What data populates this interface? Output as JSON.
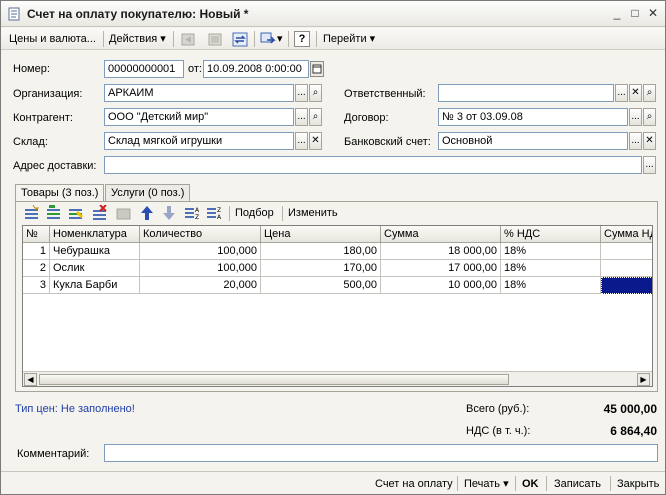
{
  "window": {
    "title": "Счет на оплату покупателю: Новый *",
    "minimize": "_",
    "maximize": "□",
    "close": "✕"
  },
  "toolbar": {
    "prices_label": "Цены и валюта...",
    "actions_label": "Действия",
    "help_label": "?",
    "goto_label": "Перейти"
  },
  "form": {
    "number_label": "Номер:",
    "number_value": "00000000001",
    "date_from_label": "от:",
    "date_value": "10.09.2008  0:00:00",
    "org_label": "Организация:",
    "org_value": "АРКАИМ",
    "responsible_label": "Ответственный:",
    "responsible_value": "",
    "contractor_label": "Контрагент:",
    "contractor_value": "ООО \"Детский мир\"",
    "contract_label": "Договор:",
    "contract_value": "№ 3 от 03.09.08",
    "warehouse_label": "Склад:",
    "warehouse_value": "Склад мягкой игрушки",
    "bank_label": "Банковский счет:",
    "bank_value": "Основной",
    "address_label": "Адрес доставки:",
    "address_value": ""
  },
  "tabs": [
    {
      "label": "Товары (3 поз.)",
      "active": true
    },
    {
      "label": "Услуги (0 поз.)",
      "active": false
    }
  ],
  "table_toolbar": {
    "pick_label": "Подбор",
    "edit_label": "Изменить"
  },
  "table": {
    "headers": [
      "№",
      "Номенклатура",
      "Количество",
      "Цена",
      "Сумма",
      "% НДС",
      "Сумма НДС"
    ],
    "rows": [
      {
        "n": "1",
        "item": "Чебурашка",
        "qty": "100,000",
        "price": "180,00",
        "sum": "18 000,00",
        "vat": "18%"
      },
      {
        "n": "2",
        "item": "Ослик",
        "qty": "100,000",
        "price": "170,00",
        "sum": "17 000,00",
        "vat": "18%"
      },
      {
        "n": "3",
        "item": "Кукла Барби",
        "qty": "20,000",
        "price": "500,00",
        "sum": "10 000,00",
        "vat": "18%"
      }
    ]
  },
  "footer": {
    "price_type": "Тип цен: Не заполнено!",
    "total_label": "Всего (руб.):",
    "total_value": "45 000,00",
    "vat_label": "НДС (в т. ч.):",
    "vat_value": "6 864,40",
    "comment_label": "Комментарий:",
    "comment_value": ""
  },
  "bottom": {
    "invoice_label": "Счет на оплату",
    "print_label": "Печать",
    "ok_label": "OK",
    "save_label": "Записать",
    "close_label": "Закрыть"
  },
  "colors": {
    "accent_blue": "#1f3ea8",
    "selection": "#0a1a8c"
  }
}
